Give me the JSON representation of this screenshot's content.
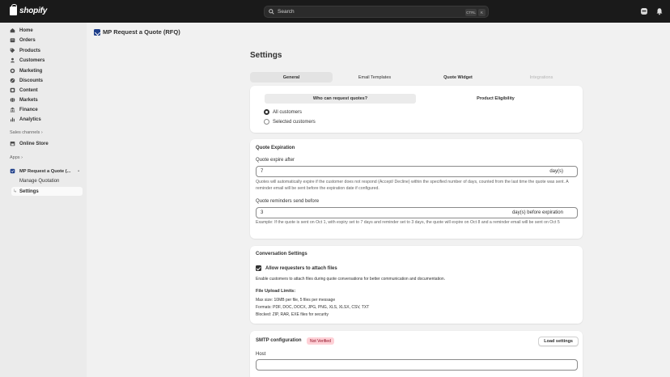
{
  "topbar": {
    "brand": "shopify",
    "search_placeholder": "Search",
    "shortcut_key1": "CTRL",
    "shortcut_key2": "K"
  },
  "sidebar": {
    "items": [
      {
        "label": "Home",
        "icon": "home-icon"
      },
      {
        "label": "Orders",
        "icon": "orders-icon"
      },
      {
        "label": "Products",
        "icon": "tag-icon"
      },
      {
        "label": "Customers",
        "icon": "person-icon"
      },
      {
        "label": "Marketing",
        "icon": "target-icon"
      },
      {
        "label": "Discounts",
        "icon": "discount-icon"
      },
      {
        "label": "Content",
        "icon": "content-icon"
      },
      {
        "label": "Markets",
        "icon": "globe-icon"
      },
      {
        "label": "Finance",
        "icon": "bank-icon"
      },
      {
        "label": "Analytics",
        "icon": "bar-chart-icon"
      }
    ],
    "sales_channels_label": "Sales channels",
    "online_store": "Online Store",
    "apps_label": "Apps",
    "app_name": "MP Request a Quote (...",
    "app_sub_items": [
      "Manage Quotation",
      "Settings"
    ]
  },
  "page": {
    "app_title": "MP Request a Quote (RFQ)",
    "settings_title": "Settings"
  },
  "tabs": [
    "General",
    "Email Templates",
    "Quote Widget",
    "Integrations"
  ],
  "who_card": {
    "subtabs": [
      "Who can request quotes?",
      "Product Eligibility"
    ],
    "options": [
      "All customers",
      "Selected customers"
    ],
    "selected": "All customers"
  },
  "expiration": {
    "title": "Quote Expiration",
    "expire_label": "Quote expire after",
    "expire_value": "7",
    "expire_suffix": "day(s)",
    "expire_help": "Quotes will automatically expire if the customer does not respond (Accept/ Decline) within the specified number of days, counted from the last time the quote was sent. A reminder email will be sent before the expiration date if configured.",
    "reminder_label": "Quote reminders send before",
    "reminder_value": "3",
    "reminder_suffix": "day(s) before expiration",
    "reminder_help": "Example: If the quote is sent on Oct 1, with expiry set to 7 days and reminder set to 3 days, the quote will expire on Oct 8 and a reminder email will be sent on Oct 5"
  },
  "conversation": {
    "title": "Conversation Settings",
    "checkbox_label": "Allow requesters to attach files",
    "checkbox_help": "Enable customers to attach files during quote conversations for better communication and documentation.",
    "limits_title": "File Upload Limits:",
    "limit_lines": [
      "Max size: 10MB per file, 5 files per message",
      "Formats: PDF, DOC, DOCX, JPG, PNG, XLS, XLSX, CSV, TXT",
      "Blocked: ZIP, RAR, EXE files for security"
    ]
  },
  "smtp": {
    "title": "SMTP configuration",
    "badge": "Not Verified",
    "load_button": "Load settings",
    "host_label": "Host",
    "host_value": ""
  },
  "colors": {
    "topbar": "#1a1a1a",
    "sidebar": "#ebebeb",
    "background": "#f1f1f1",
    "badge_bg": "#fed1d7",
    "badge_text": "#8e0b21"
  }
}
